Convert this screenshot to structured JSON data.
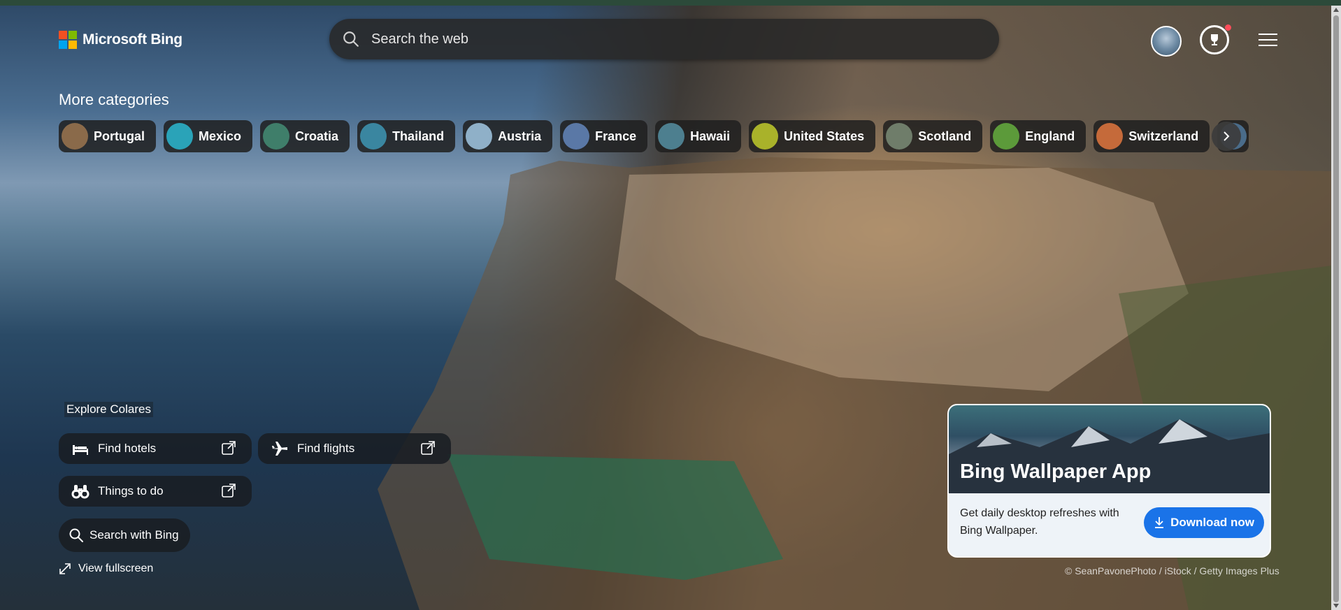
{
  "header": {
    "logo_text": "Microsoft Bing",
    "search_placeholder": "Search the web"
  },
  "categories": {
    "title": "More categories",
    "items": [
      {
        "label": "Portugal",
        "color": "#8a6a4a"
      },
      {
        "label": "Mexico",
        "color": "#2aa3b8"
      },
      {
        "label": "Croatia",
        "color": "#3f7e6a"
      },
      {
        "label": "Thailand",
        "color": "#3a86a0"
      },
      {
        "label": "Austria",
        "color": "#8fb0c8"
      },
      {
        "label": "France",
        "color": "#5a78a6"
      },
      {
        "label": "Hawaii",
        "color": "#4d7f8f"
      },
      {
        "label": "United States",
        "color": "#a9b22a"
      },
      {
        "label": "Scotland",
        "color": "#6f7d6a"
      },
      {
        "label": "England",
        "color": "#5c9a3a"
      },
      {
        "label": "Switzerland",
        "color": "#c56a3a"
      }
    ]
  },
  "explore": {
    "title": "Explore Colares",
    "find_hotels": "Find hotels",
    "find_flights": "Find flights",
    "things_to_do": "Things to do",
    "search_with_bing": "Search with Bing",
    "view_fullscreen": "View fullscreen"
  },
  "promo": {
    "title": "Bing Wallpaper App",
    "description": "Get daily desktop refreshes with Bing Wallpaper.",
    "button": "Download now"
  },
  "credit": "© SeanPavonePhoto / iStock / Getty Images Plus",
  "colors": {
    "ms_red": "#f25022",
    "ms_green": "#7fba00",
    "ms_blue": "#00a4ef",
    "ms_yellow": "#ffb900",
    "accent": "#1a73e8"
  }
}
